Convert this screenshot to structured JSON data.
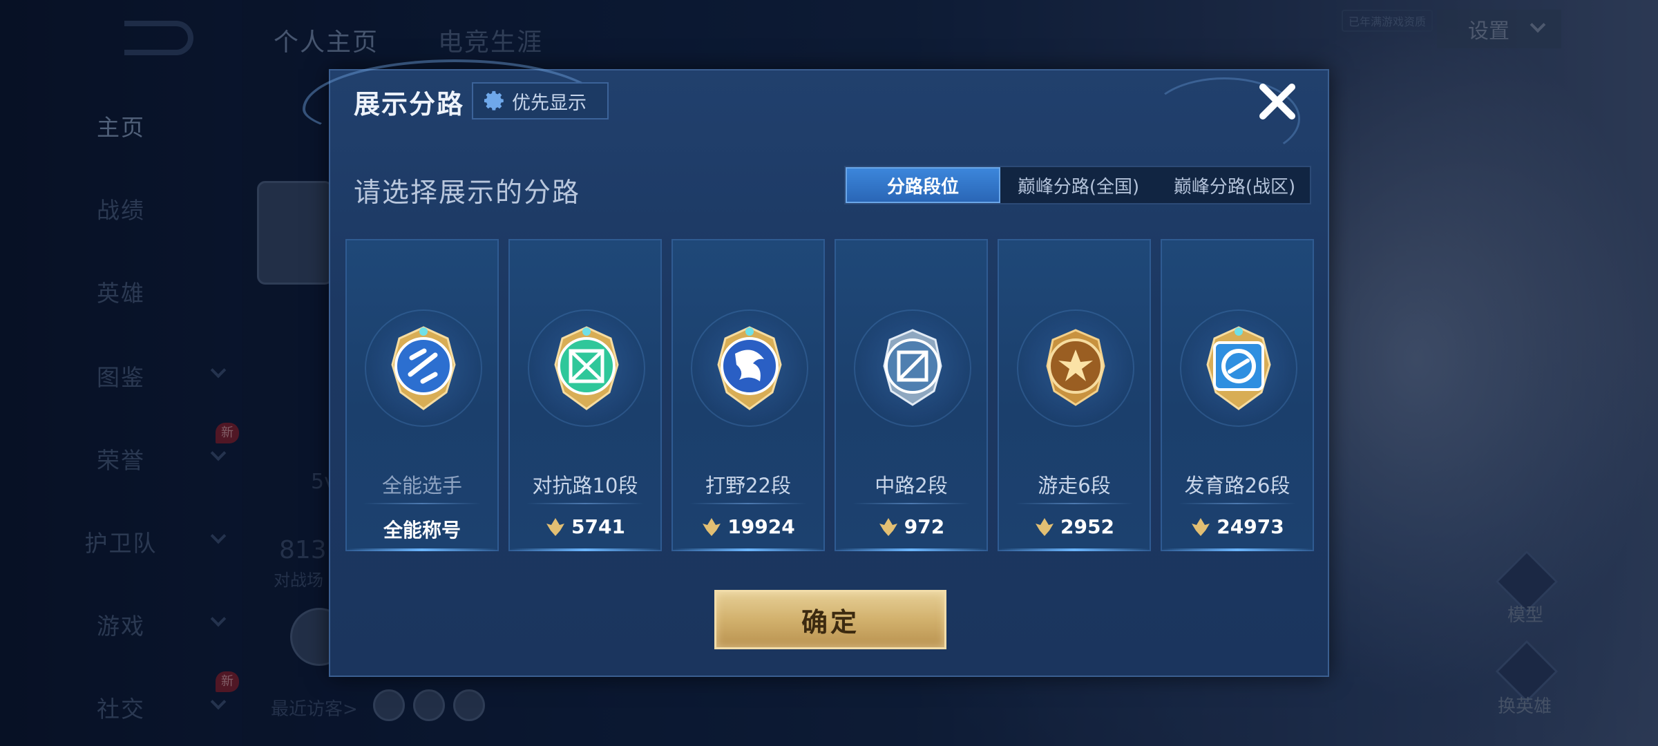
{
  "background": {
    "nav": {
      "items": [
        "主页",
        "战绩",
        "英雄",
        "图鉴",
        "荣誉",
        "护卫队",
        "游戏",
        "社交"
      ],
      "new_badge": "新"
    },
    "top_tabs": [
      "个人主页",
      "电竞生涯"
    ],
    "settings_label": "设置",
    "age_tag": "已年满游戏资质",
    "fragments": {
      "games_count": "813",
      "games_label": "对战场",
      "five_v": "5v",
      "recent_visitors": "最近访客>"
    },
    "side_buttons": [
      "模型",
      "换英雄"
    ]
  },
  "modal": {
    "title": "展示分路",
    "priority_label": "优先显示",
    "subtitle": "请选择展示的分路",
    "segments": [
      "分路段位",
      "巅峰分路(全国)",
      "巅峰分路(战区)"
    ],
    "active_segment": "分路段位",
    "cards": [
      {
        "title": "全能选手",
        "value": "全能称号",
        "icon": "all-round-badge",
        "has_value_icon": false
      },
      {
        "title": "对抗路10段",
        "value": "5741",
        "icon": "clash-lane-badge",
        "has_value_icon": true
      },
      {
        "title": "打野22段",
        "value": "19924",
        "icon": "jungle-badge",
        "has_value_icon": true
      },
      {
        "title": "中路2段",
        "value": "972",
        "icon": "mid-lane-badge",
        "has_value_icon": true
      },
      {
        "title": "游走6段",
        "value": "2952",
        "icon": "roam-badge",
        "has_value_icon": true
      },
      {
        "title": "发育路26段",
        "value": "24973",
        "icon": "farm-lane-badge",
        "has_value_icon": true
      }
    ],
    "confirm_label": "确定"
  },
  "colors": {
    "modal_bg": "#1c3862",
    "active_tab": "#3c86db",
    "confirm_gold": "#d2b16d"
  }
}
